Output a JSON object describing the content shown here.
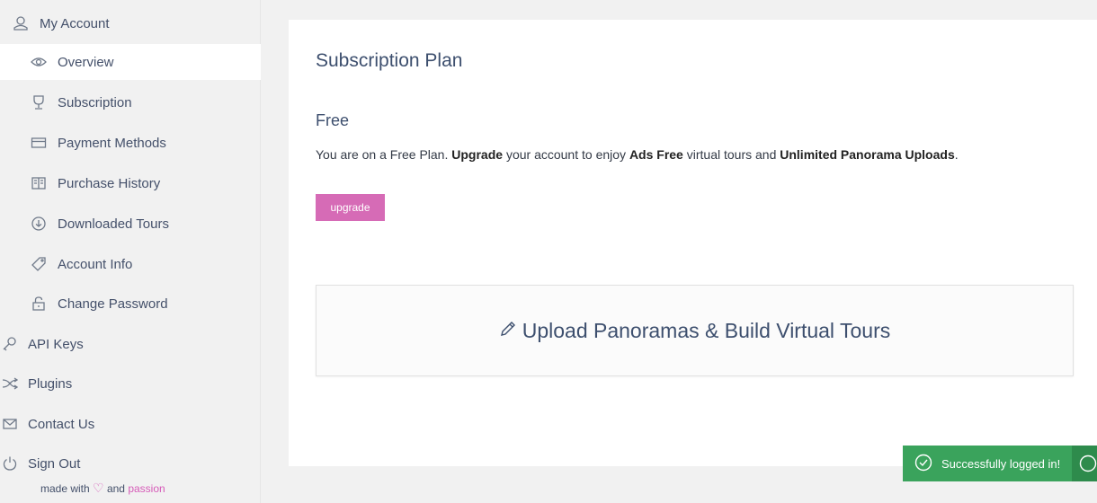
{
  "sidebar": {
    "items": [
      {
        "label": "My Account",
        "icon": "user-icon"
      },
      {
        "label": "Overview",
        "icon": "eye-icon"
      },
      {
        "label": "Subscription",
        "icon": "trophy-icon"
      },
      {
        "label": "Payment Methods",
        "icon": "credit-card-icon"
      },
      {
        "label": "Purchase History",
        "icon": "book-icon"
      },
      {
        "label": "Downloaded Tours",
        "icon": "download-icon"
      },
      {
        "label": "Account Info",
        "icon": "tag-icon"
      },
      {
        "label": "Change Password",
        "icon": "lock-icon"
      },
      {
        "label": "API Keys",
        "icon": "key-icon"
      },
      {
        "label": "Plugins",
        "icon": "shuffle-icon"
      },
      {
        "label": "Contact Us",
        "icon": "envelope-icon"
      },
      {
        "label": "Sign Out",
        "icon": "power-icon"
      }
    ],
    "active": "Overview",
    "made_with": {
      "prefix": "made with",
      "heart": "♡",
      "and": "and",
      "passion": "passion"
    }
  },
  "main": {
    "title": "Subscription Plan",
    "plan_name": "Free",
    "desc": {
      "p1": "You are on a Free Plan. ",
      "b1": "Upgrade",
      "p2": " your account to enjoy ",
      "b2": "Ads Free",
      "p3": " virtual tours and ",
      "b3": "Unlimited Panorama Uploads",
      "p4": "."
    },
    "upgrade_label": "upgrade",
    "upload_label": "Upload Panoramas & Build Virtual Tours"
  },
  "toast": {
    "message": "Successfully logged in!",
    "color": "#3aa35c"
  },
  "colors": {
    "accent": "#d66bb6",
    "text": "#3d4f6e",
    "background": "#f1f1f1"
  }
}
